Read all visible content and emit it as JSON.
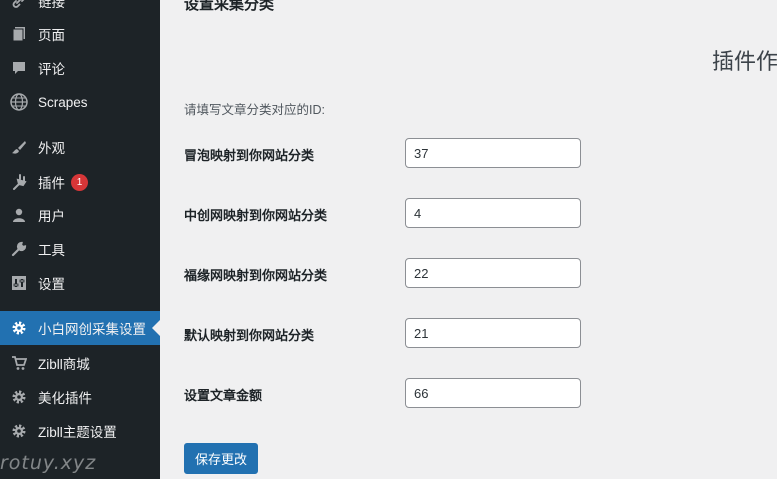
{
  "sidebar": {
    "items": [
      {
        "label": "链接",
        "icon": "link-icon"
      },
      {
        "label": "页面",
        "icon": "page-icon"
      },
      {
        "label": "评论",
        "icon": "comment-icon"
      },
      {
        "label": "Scrapes",
        "icon": "globe-icon"
      },
      {
        "label": "外观",
        "icon": "brush-icon"
      },
      {
        "label": "插件",
        "icon": "plugin-icon",
        "badge": "1"
      },
      {
        "label": "用户",
        "icon": "user-icon"
      },
      {
        "label": "工具",
        "icon": "wrench-icon"
      },
      {
        "label": "设置",
        "icon": "settings-icon"
      },
      {
        "label": "小白网创采集设置",
        "icon": "gear-icon",
        "active": true
      },
      {
        "label": "Zibll商城",
        "icon": "cart-icon"
      },
      {
        "label": "美化插件",
        "icon": "gear-icon"
      },
      {
        "label": "Zibll主题设置",
        "icon": "gear-icon"
      }
    ],
    "watermark": "rotuy.xyz"
  },
  "main": {
    "title": "设置采集分类",
    "right_heading": "插件作",
    "intro": "请填写文章分类对应的ID:",
    "fields": [
      {
        "label": "冒泡映射到你网站分类",
        "value": "37"
      },
      {
        "label": "中创网映射到你网站分类",
        "value": "4"
      },
      {
        "label": "福缘网映射到你网站分类",
        "value": "22"
      },
      {
        "label": "默认映射到你网站分类",
        "value": "21"
      },
      {
        "label": "设置文章金额",
        "value": "66"
      }
    ],
    "save_label": "保存更改"
  },
  "colors": {
    "sidebar_bg": "#1d2327",
    "accent": "#2271b1",
    "badge": "#d63638",
    "page_bg": "#f0f0f1"
  }
}
